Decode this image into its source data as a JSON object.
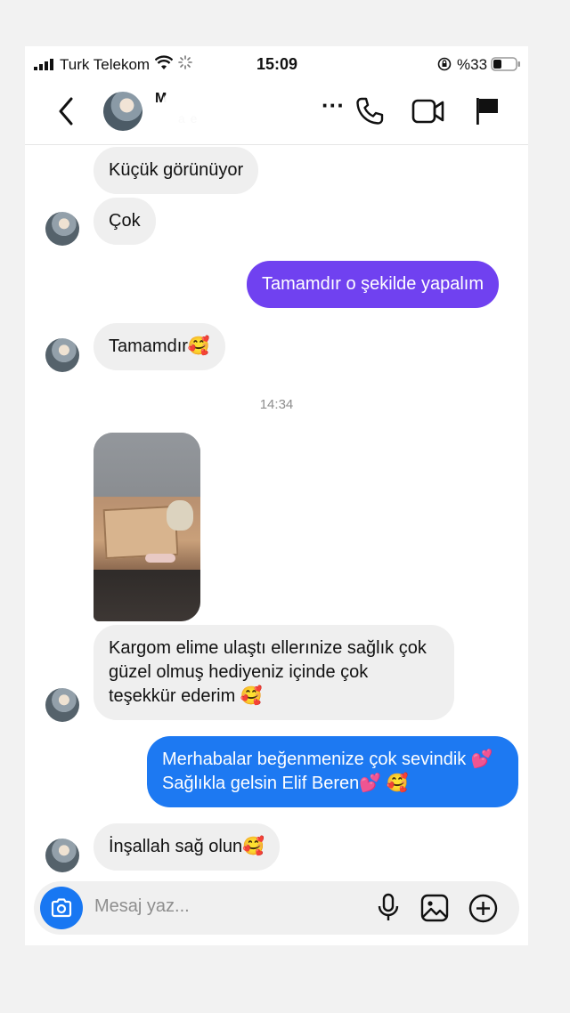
{
  "status_bar": {
    "carrier": "Turk Telekom",
    "time": "15:09",
    "battery": "%33",
    "icons": [
      "signal-icon",
      "wifi-icon",
      "loading-icon",
      "rotation-lock-icon",
      "battery-icon"
    ]
  },
  "header": {
    "contact_name": "M",
    "contact_subtitle": "a e",
    "icons": [
      "back-icon",
      "more-icon",
      "phone-icon",
      "video-icon",
      "flag-icon"
    ],
    "more_symbol": "···"
  },
  "messages": [
    {
      "id": "m1",
      "direction": "incoming",
      "text": "Küçük görünüyor"
    },
    {
      "id": "m2",
      "direction": "incoming",
      "text": "Çok"
    },
    {
      "id": "m3",
      "direction": "outgoing",
      "text": "Tamamdır o şekilde yapalım",
      "color": "#7041f0"
    },
    {
      "id": "m4",
      "direction": "incoming",
      "text": "Tamamdır🥰"
    },
    {
      "id": "m5",
      "direction": "incoming",
      "type": "photo"
    },
    {
      "id": "m6",
      "direction": "incoming",
      "text": "Kargom elime ulaştı ellerınize sağlık çok güzel olmuş hediyeniz içinde çok teşekkür ederim 🥰"
    },
    {
      "id": "m7",
      "direction": "outgoing",
      "text": "Merhabalar beğenmenize çok sevindik 💕 Sağlıkla gelsin Elif Beren💕 🥰",
      "color": "#1d79f2"
    },
    {
      "id": "m8",
      "direction": "incoming",
      "text": "İnşallah sağ olun🥰"
    }
  ],
  "timestamp": "14:34",
  "composer": {
    "placeholder": "Mesaj yaz...",
    "icons": [
      "camera-icon",
      "microphone-icon",
      "gallery-icon",
      "plus-icon"
    ]
  },
  "colors": {
    "incoming_bubble": "#efefef",
    "outgoing_purple": "#7041f0",
    "outgoing_blue": "#1d79f2",
    "camera_button": "#1877f2"
  }
}
